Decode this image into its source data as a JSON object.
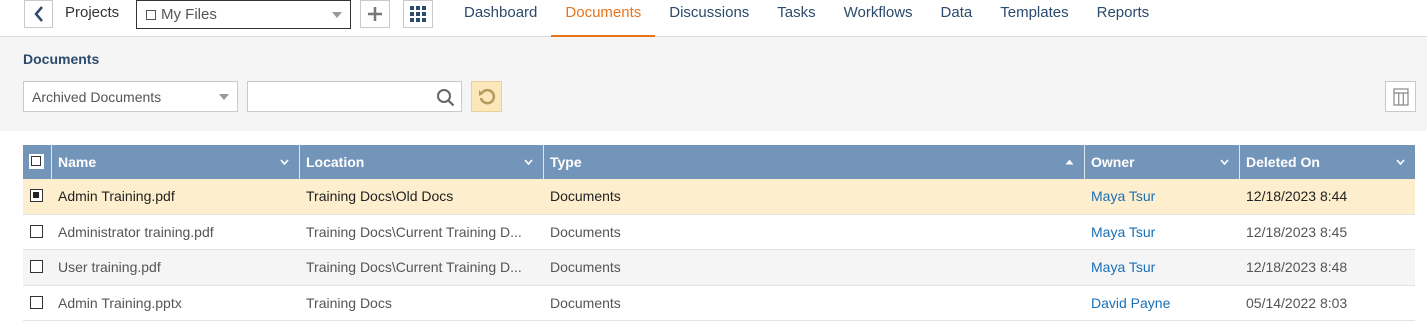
{
  "nav": {
    "projects_label": "Projects",
    "project_selector": "My Files",
    "tabs": [
      {
        "label": "Dashboard",
        "active": false
      },
      {
        "label": "Documents",
        "active": true
      },
      {
        "label": "Discussions",
        "active": false
      },
      {
        "label": "Tasks",
        "active": false
      },
      {
        "label": "Workflows",
        "active": false
      },
      {
        "label": "Data",
        "active": false
      },
      {
        "label": "Templates",
        "active": false
      },
      {
        "label": "Reports",
        "active": false
      }
    ]
  },
  "toolbar": {
    "section_title": "Documents",
    "view_select": "Archived Documents",
    "search_value": "",
    "search_placeholder": ""
  },
  "table": {
    "columns": [
      "Name",
      "Location",
      "Type",
      "Owner",
      "Deleted On"
    ],
    "sorted_column": "Type",
    "sort_direction": "ascending",
    "rows": [
      {
        "name": "Admin Training.pdf",
        "location": "Training Docs\\Old Docs",
        "type": "Documents",
        "owner": "Maya Tsur",
        "deleted_on": "12/18/2023 8:44",
        "selected": true
      },
      {
        "name": "Administrator training.pdf",
        "location": "Training Docs\\Current Training D...",
        "type": "Documents",
        "owner": "Maya Tsur",
        "deleted_on": "12/18/2023 8:45",
        "selected": false
      },
      {
        "name": "User training.pdf",
        "location": "Training Docs\\Current Training D...",
        "type": "Documents",
        "owner": "Maya Tsur",
        "deleted_on": "12/18/2023 8:48",
        "selected": false
      },
      {
        "name": "Admin Training.pptx",
        "location": "Training Docs",
        "type": "Documents",
        "owner": "David Payne",
        "deleted_on": "05/14/2022 8:03",
        "selected": false
      }
    ]
  },
  "colors": {
    "accent": "#e8731d",
    "nav_text": "#2c4a6b",
    "header_bg": "#7495ba",
    "selected_row": "#fdefcd",
    "link": "#1a6fb8"
  }
}
